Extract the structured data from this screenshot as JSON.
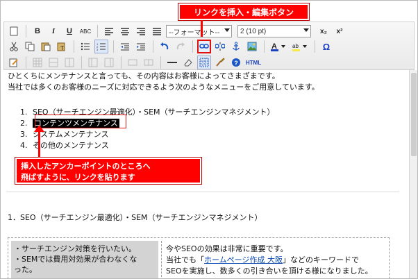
{
  "callouts": {
    "top": "リンクを挿入・編集ボタン",
    "bottom_line1": "挿入したアンカーポイントのところへ",
    "bottom_line2": "飛ばすように、リンクを貼ります"
  },
  "toolbar": {
    "format_combo": "--フォーマット--",
    "size_combo": "2 (10 pt)",
    "bold": "B",
    "italic": "I",
    "underline": "U",
    "strike": "ABC",
    "subscript": "x₂",
    "superscript": "x²",
    "omega": "Ω",
    "html": "HTML"
  },
  "content": {
    "intro_line1": "ひとくちにメンテナンスと言っても、その内容はお客様によってさまざまです。",
    "intro_line2": "当社では多くのお客様のニーズに対応できるよう次のようなメニューをご用意しています。",
    "list": [
      {
        "num": "1.",
        "text": "SEO（サーチエンジン最適化）・SEM（サーチエンジンマネジメント）"
      },
      {
        "num": "2.",
        "text": "コンテンツメンテナンス"
      },
      {
        "num": "3.",
        "text": "システムメンテナンス"
      },
      {
        "num": "4.",
        "text": "その他のメンテナンス"
      }
    ],
    "section_heading": "1．SEO（サーチエンジン最適化）・SEM（サーチエンジンマネジメント）",
    "left_cell": [
      "・サーチエンジン対策を行いたい。",
      "・SEMでは費用対効果が合わなくな",
      "った。"
    ],
    "right_line1": "今やSEOの効果は非常に重要です。",
    "right_line2_prefix": "当社でも「",
    "right_link": "ホームページ作成 大阪",
    "right_line2_suffix": "」などのキーワードで",
    "right_line3": "SEOを実施し、数多くの引き合いを頂ける様になりました。"
  }
}
